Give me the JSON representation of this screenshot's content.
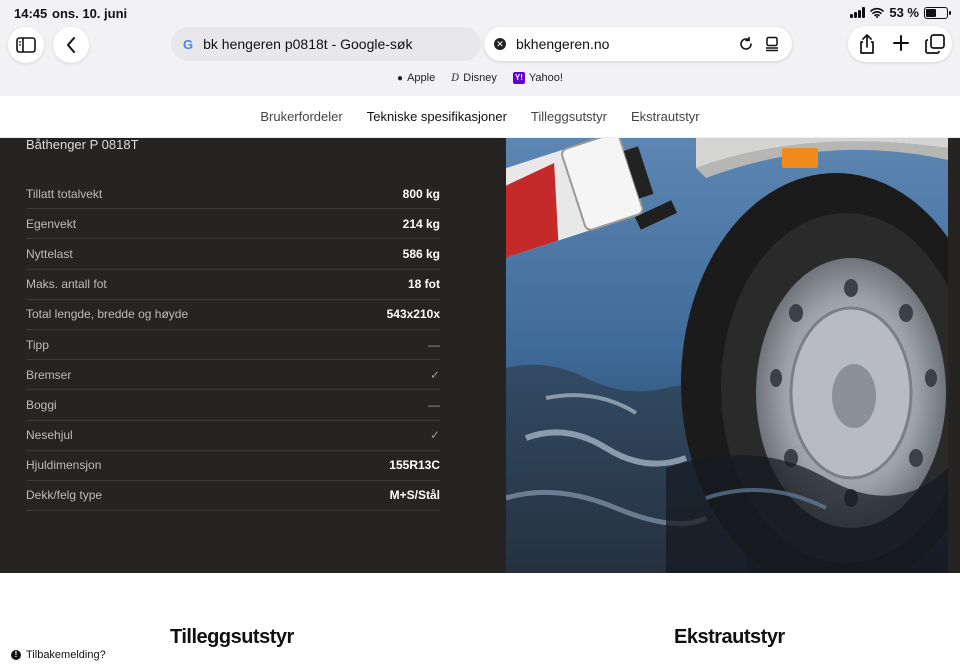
{
  "status": {
    "time": "14:45",
    "date": "ons. 10. juni",
    "battery": "53 %",
    "battery_level": 0.53
  },
  "browser": {
    "tab_title": "bk hengeren p0818t - Google-søk",
    "address": "bkhengeren.no",
    "favorites": [
      {
        "label": "Apple",
        "icon": "apple-icon"
      },
      {
        "label": "Disney",
        "icon": "disney-icon"
      },
      {
        "label": "Yahoo!",
        "icon": "yahoo-icon"
      }
    ]
  },
  "nav": {
    "items": [
      "Brukerfordeler",
      "Tekniske spesifikasjoner",
      "Tilleggsutstyr",
      "Ekstrautstyr"
    ],
    "active": "Tekniske spesifikasjoner"
  },
  "specs": {
    "title": "Båthenger P 0818T",
    "rows": [
      {
        "label": "Tillatt totalvekt",
        "value": "800 kg"
      },
      {
        "label": "Egenvekt",
        "value": "214 kg"
      },
      {
        "label": "Nyttelast",
        "value": "586 kg"
      },
      {
        "label": "Maks. antall fot",
        "value": "18 fot"
      },
      {
        "label": "Total lengde, bredde og høyde",
        "value": "543x210x"
      },
      {
        "label": "Tipp",
        "value": "—"
      },
      {
        "label": "Bremser",
        "value": "✓"
      },
      {
        "label": "Boggi",
        "value": "—"
      },
      {
        "label": "Nesehjul",
        "value": "✓"
      },
      {
        "label": "Hjuldimensjon",
        "value": "155R13C"
      },
      {
        "label": "Dekk/felg type",
        "value": "M+S/Stål"
      }
    ]
  },
  "sections": {
    "left": "Tilleggsutstyr",
    "right": "Ekstrautstyr"
  },
  "feedback": "Tilbakemelding?"
}
